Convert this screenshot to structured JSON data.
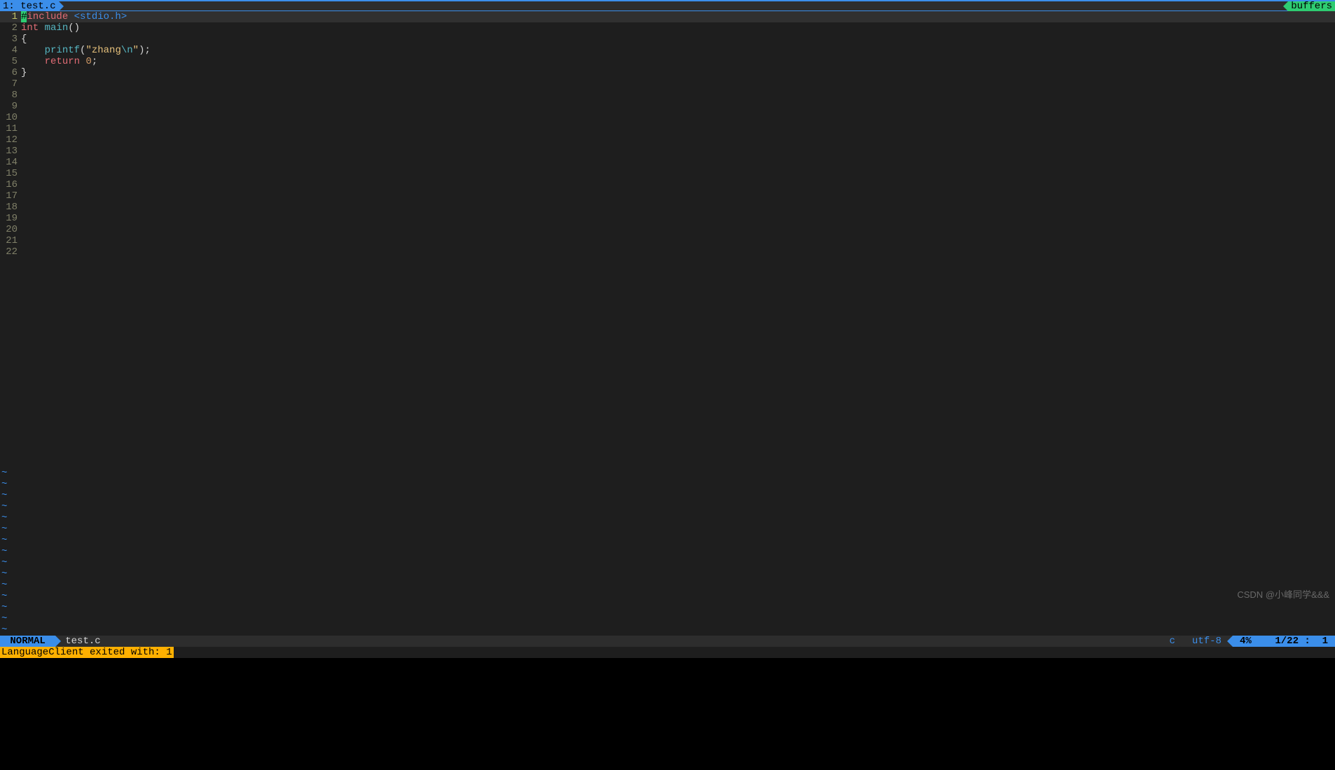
{
  "tabline": {
    "left_tab": "1: test.c",
    "right_tab": "buffers"
  },
  "editor": {
    "total_lines": 22,
    "current_line": 1,
    "code_lines": [
      {
        "n": 1,
        "tokens": [
          {
            "t": "#",
            "cls": "cursor"
          },
          {
            "t": "include ",
            "cls": "tok-preproc"
          },
          {
            "t": "<stdio.h>",
            "cls": "tok-include"
          }
        ]
      },
      {
        "n": 2,
        "tokens": [
          {
            "t": "int",
            "cls": "tok-type"
          },
          {
            "t": " ",
            "cls": ""
          },
          {
            "t": "main",
            "cls": "tok-func"
          },
          {
            "t": "()",
            "cls": "tok-punct"
          }
        ]
      },
      {
        "n": 3,
        "tokens": [
          {
            "t": "{",
            "cls": "tok-punct"
          }
        ]
      },
      {
        "n": 4,
        "tokens": [
          {
            "t": "    ",
            "cls": ""
          },
          {
            "t": "printf",
            "cls": "tok-func"
          },
          {
            "t": "(",
            "cls": "tok-punct"
          },
          {
            "t": "\"zhang",
            "cls": "tok-string"
          },
          {
            "t": "\\n",
            "cls": "tok-escape"
          },
          {
            "t": "\"",
            "cls": "tok-string"
          },
          {
            "t": ");",
            "cls": "tok-punct"
          }
        ]
      },
      {
        "n": 5,
        "tokens": [
          {
            "t": "    ",
            "cls": ""
          },
          {
            "t": "return",
            "cls": "tok-keyword"
          },
          {
            "t": " ",
            "cls": ""
          },
          {
            "t": "0",
            "cls": "tok-number"
          },
          {
            "t": ";",
            "cls": "tok-punct"
          }
        ]
      },
      {
        "n": 6,
        "tokens": [
          {
            "t": "}",
            "cls": "tok-punct"
          }
        ]
      }
    ],
    "tilde_count": 15
  },
  "statusline": {
    "mode": "NORMAL",
    "filename": "test.c",
    "filetype": "c",
    "encoding": "utf-8",
    "percent": "4%",
    "line": "1",
    "total": "22",
    "col": "1"
  },
  "command": {
    "message": "LanguageClient exited with: 1"
  },
  "watermark": "CSDN @小峰同学&&&"
}
